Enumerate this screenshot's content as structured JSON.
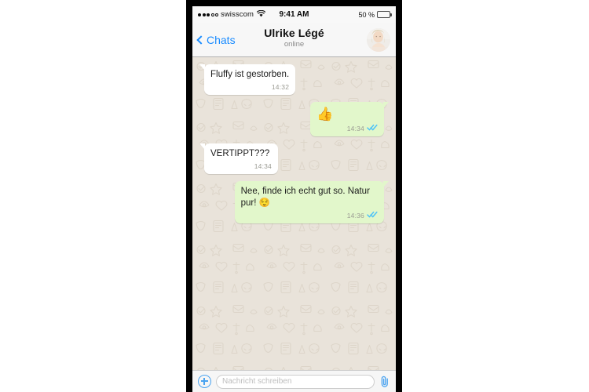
{
  "device": {
    "frame_color": "#000000",
    "screen_background": "#ffffff"
  },
  "status_bar": {
    "carrier": "swisscom",
    "signal_bars_filled": 3,
    "signal_bars_total": 5,
    "wifi_icon": "wifi-icon",
    "time": "9:41 AM",
    "battery_label": "50 %",
    "battery_percent": 50
  },
  "nav_bar": {
    "back_label": "Chats",
    "back_icon": "chevron-left-icon",
    "title": "Ulrike Légé",
    "subtitle": "online",
    "avatar_icon": "contact-avatar"
  },
  "chat": {
    "background_color": "#e9e3da",
    "bubble_in_color": "#ffffff",
    "bubble_out_color": "#e2f7cb",
    "tick_color": "#4fc3f7",
    "messages": [
      {
        "id": "m1",
        "direction": "in",
        "text": "Fluffy ist gestorben.",
        "time": "14:32",
        "status": "",
        "emoji_only": false
      },
      {
        "id": "m2",
        "direction": "out",
        "text": "👍",
        "time": "14:34",
        "status": "read",
        "emoji_only": true
      },
      {
        "id": "m3",
        "direction": "in",
        "text": "VERTIPPT???",
        "time": "14:34",
        "status": "",
        "emoji_only": false
      },
      {
        "id": "m4",
        "direction": "out",
        "text": "Nee, finde ich echt gut so. Natur pur! 😌",
        "time": "14:36",
        "status": "read",
        "emoji_only": false
      }
    ]
  },
  "input_bar": {
    "plus_icon": "plus-circle-icon",
    "placeholder": "Nachricht schreiben",
    "value": "",
    "attach_icon": "paperclip-icon"
  }
}
